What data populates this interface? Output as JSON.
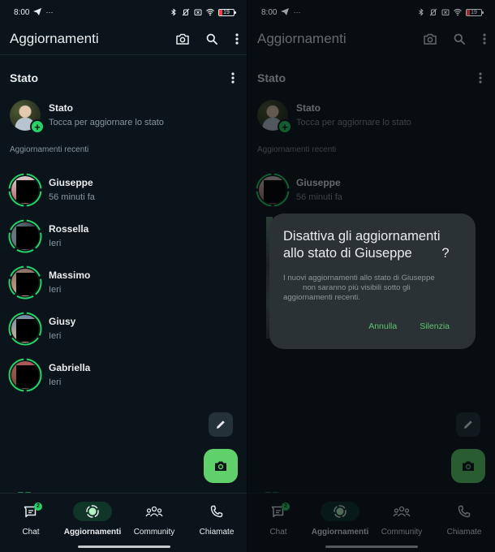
{
  "status_bar": {
    "time": "8:00",
    "telegram_icon": "telegram-send-icon",
    "overflow": "···",
    "battery_level": "19",
    "icons": [
      "bluetooth-icon",
      "vibrate-off-icon",
      "no-sim-icon",
      "wifi-icon",
      "battery-icon"
    ]
  },
  "app_bar": {
    "title": "Aggiornamenti",
    "actions": [
      "camera-icon",
      "search-icon",
      "more-vert-icon"
    ]
  },
  "status_section": {
    "title": "Stato",
    "my_status": {
      "name": "Stato",
      "subtitle": "Tocca per aggiornare lo stato"
    },
    "recent_label": "Aggiornamenti recenti",
    "recent": [
      {
        "name": "Giuseppe",
        "time": "56 minuti fa",
        "segments": 4
      },
      {
        "name": "Rossella",
        "time": "Ieri",
        "segments": 5
      },
      {
        "name": "Massimo",
        "time": "Ieri",
        "segments": 5
      },
      {
        "name": "Giusy",
        "time": "Ieri",
        "segments": 3
      },
      {
        "name": "Gabriella",
        "time": "Ieri",
        "segments": 2
      }
    ]
  },
  "fabs": {
    "edit": "pencil-icon",
    "camera": "camera-icon"
  },
  "bottom_nav": {
    "items": [
      {
        "label": "Chat",
        "badge": "2",
        "active": false
      },
      {
        "label": "Aggiornamenti",
        "active": true
      },
      {
        "label": "Community",
        "active": false
      },
      {
        "label": "Chiamate",
        "active": false
      }
    ]
  },
  "dialog": {
    "title": "Disattiva gli aggiornamenti\nallo stato di Giuseppe        ?",
    "body": "I nuovi aggiornamenti allo stato di Giuseppe\n         non saranno più visibili sotto gli\naggiornamenti recenti.",
    "cancel_label": "Annulla",
    "confirm_label": "Silenzia"
  },
  "colors": {
    "background": "#0b141a",
    "accent_green": "#25d366",
    "fab_green": "#60d06a",
    "dialog_bg": "#2b3235",
    "dialog_button": "#5fc372",
    "secondary_text": "#8696a0"
  }
}
